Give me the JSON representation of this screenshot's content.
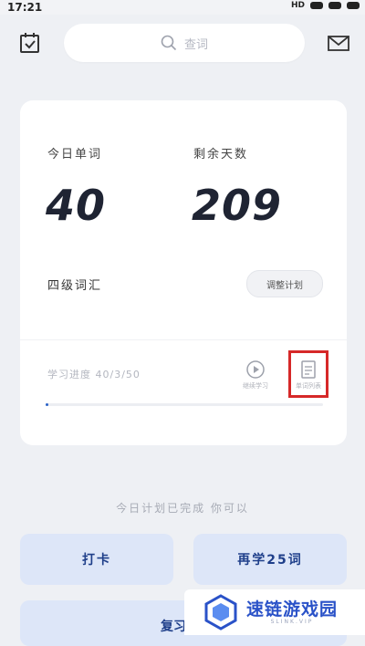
{
  "status_bar": {
    "time": "17:21",
    "network": "HD"
  },
  "search": {
    "placeholder": "查词"
  },
  "stats": {
    "today_label": "今日单词",
    "today_value": "40",
    "remaining_label": "剩余天数",
    "remaining_value": "209"
  },
  "plan": {
    "name": "四级词汇",
    "adjust_label": "调整计划"
  },
  "progress": {
    "text": "学习进度 40/3/50",
    "fraction": 0.01
  },
  "actions": {
    "continue_label": "继续学习",
    "wordlist_label": "单词列表"
  },
  "footer": {
    "done_text": "今日计划已完成 你可以",
    "checkin_label": "打卡",
    "review_label": "再学25词",
    "bottom_label": "复习"
  },
  "watermark": {
    "title": "速链游戏园",
    "subtitle": "SLINK.VIP"
  },
  "colors": {
    "accent": "#2b63c8",
    "button_bg": "#dde6f8",
    "highlight": "#d62828"
  }
}
